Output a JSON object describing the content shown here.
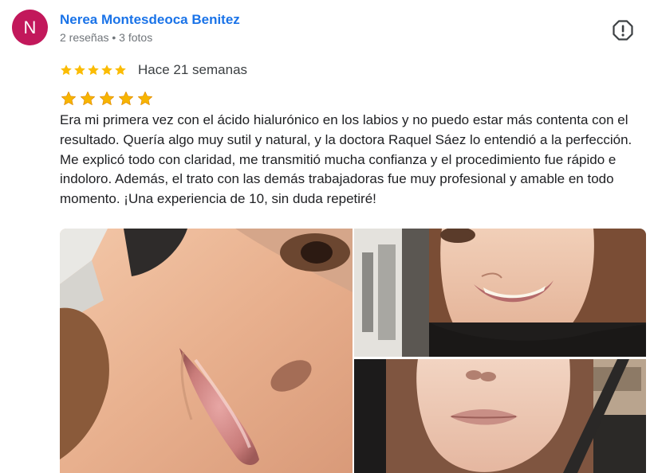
{
  "review": {
    "author": {
      "initial": "N",
      "name": "Nerea Montesdeoca Benitez",
      "meta": "2 reseñas • 3 fotos",
      "avatar_color": "#c2185b"
    },
    "report_icon": "report-flag-icon",
    "rating": {
      "value": 5,
      "max": 5,
      "star_color": "#fbbc04"
    },
    "time_ago": "Hace 21 semanas",
    "emoji_stars": "⭐⭐⭐⭐⭐",
    "text": "Era mi primera vez con el ácido hialurónico en los labios y no puedo estar más contenta con el resultado. Quería algo muy sutil y natural, y la doctora Raquel Sáez lo entendió a la perfección. Me explicó todo con claridad, me transmitió mucha confianza y el procedimiento fue rápido e indoloro. Además, el trato con las demás trabajadoras fue muy profesional y amable en todo momento. ¡Una experiencia de 10, sin duda repetiré!",
    "photos": [
      {
        "name": "review-photo-lips-closeup"
      },
      {
        "name": "review-photo-smile"
      },
      {
        "name": "review-photo-car-selfie"
      }
    ]
  }
}
